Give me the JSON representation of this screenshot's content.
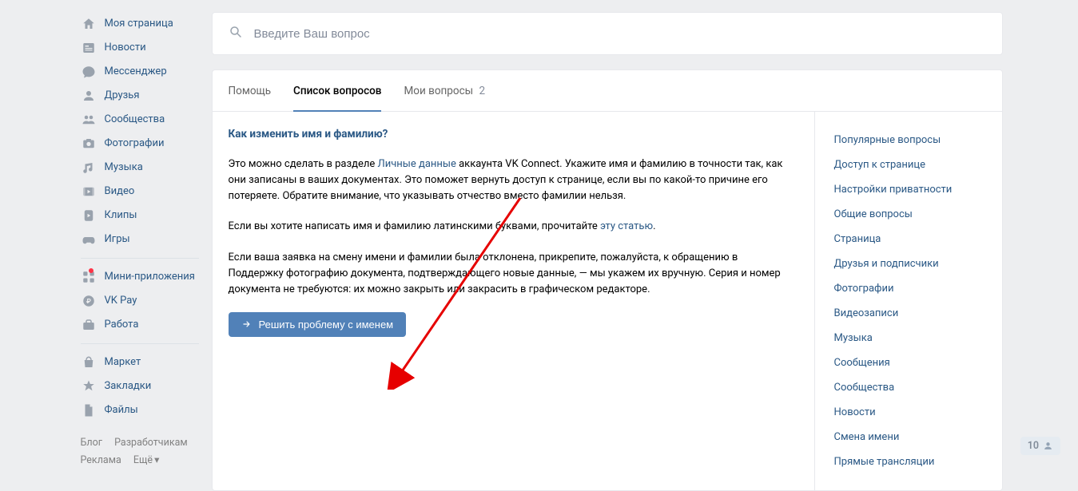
{
  "sidebar": {
    "groups": [
      [
        {
          "icon": "home",
          "label": "Моя страница"
        },
        {
          "icon": "news",
          "label": "Новости"
        },
        {
          "icon": "messenger",
          "label": "Мессенджер"
        },
        {
          "icon": "friends",
          "label": "Друзья"
        },
        {
          "icon": "community",
          "label": "Сообщества"
        },
        {
          "icon": "photo",
          "label": "Фотографии"
        },
        {
          "icon": "music",
          "label": "Музыка"
        },
        {
          "icon": "video",
          "label": "Видео"
        },
        {
          "icon": "clips",
          "label": "Клипы"
        },
        {
          "icon": "games",
          "label": "Игры"
        }
      ],
      [
        {
          "icon": "miniapps",
          "label": "Мини-приложения",
          "dot": true
        },
        {
          "icon": "vkpay",
          "label": "VK Pay"
        },
        {
          "icon": "work",
          "label": "Работа"
        }
      ],
      [
        {
          "icon": "market",
          "label": "Маркет"
        },
        {
          "icon": "bookmarks",
          "label": "Закладки"
        },
        {
          "icon": "files",
          "label": "Файлы"
        }
      ]
    ],
    "footer": {
      "blog": "Блог",
      "developers": "Разработчикам",
      "ads": "Реклама",
      "more": "Ещё"
    }
  },
  "search": {
    "placeholder": "Введите Ваш вопрос"
  },
  "tabs": {
    "help": "Помощь",
    "list": "Список вопросов",
    "mine": "Мои вопросы",
    "mine_count": "2"
  },
  "article": {
    "title": "Как изменить имя и фамилию?",
    "p1a": "Это можно сделать в разделе ",
    "p1link": "Личные данные",
    "p1b": " аккаунта VK Connect. Укажите имя и фамилию в точности так, как они записаны в ваших документах. Это поможет вернуть доступ к странице, если вы по какой-то причине его потеряете. Обратите внимание, что указывать отчество вместо фамилии нельзя.",
    "p2a": "Если вы хотите написать имя и фамилию латинскими буквами, прочитайте ",
    "p2link": "эту статью",
    "p2b": ".",
    "p3": "Если ваша заявка на смену имени и фамилии была отклонена, прикрепите, пожалуйста, к обращению в Поддержку фотографию документа, подтверждающего новые данные, — мы укажем их вручную. Серия и номер документа не требуются: их можно закрыть или закрасить в графическом редакторе.",
    "button": "Решить проблему с именем"
  },
  "categories": [
    "Популярные вопросы",
    "Доступ к странице",
    "Настройки приватности",
    "Общие вопросы",
    "Страница",
    "Друзья и подписчики",
    "Фотографии",
    "Видеозаписи",
    "Музыка",
    "Сообщения",
    "Сообщества",
    "Новости",
    "Смена имени",
    "Прямые трансляции"
  ],
  "friends_online": "10"
}
